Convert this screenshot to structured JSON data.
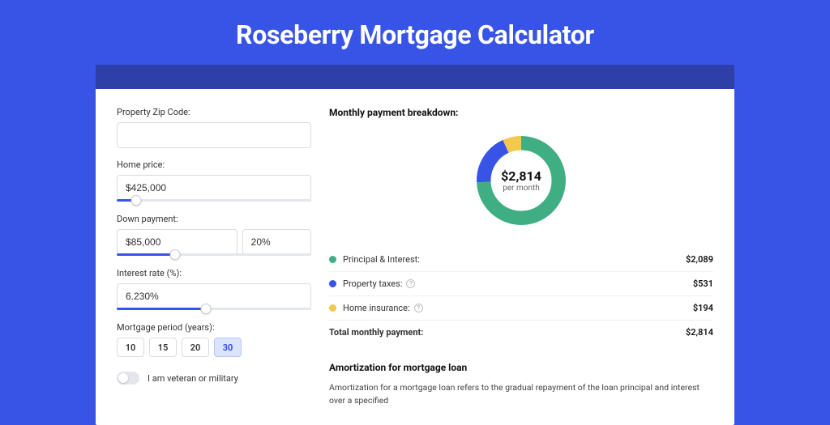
{
  "page_title": "Roseberry Mortgage Calculator",
  "form": {
    "zip": {
      "label": "Property Zip Code:",
      "value": ""
    },
    "home_price": {
      "label": "Home price:",
      "value": "$425,000",
      "slider_pct": 10
    },
    "down_payment": {
      "label": "Down payment:",
      "amount": "$85,000",
      "percent": "20%",
      "slider_pct": 30
    },
    "interest_rate": {
      "label": "Interest rate (%):",
      "value": "6.230%",
      "slider_pct": 46
    },
    "mortgage_period": {
      "label": "Mortgage period (years):",
      "options": [
        "10",
        "15",
        "20",
        "30"
      ],
      "selected": "30"
    },
    "veteran": {
      "label": "I am veteran or military",
      "on": false
    }
  },
  "breakdown": {
    "title": "Monthly payment breakdown:",
    "center_amount": "$2,814",
    "center_sub": "per month",
    "items": [
      {
        "label": "Principal & Interest:",
        "value": "$2,089",
        "color": "#3fae82",
        "info": false
      },
      {
        "label": "Property taxes:",
        "value": "$531",
        "color": "#3754e6",
        "info": true
      },
      {
        "label": "Home insurance:",
        "value": "$194",
        "color": "#f2c94c",
        "info": true
      }
    ],
    "total": {
      "label": "Total monthly payment:",
      "value": "$2,814"
    }
  },
  "chart_data": {
    "type": "pie",
    "title": "Monthly payment breakdown",
    "series": [
      {
        "name": "Principal & Interest",
        "value": 2089,
        "color": "#3fae82"
      },
      {
        "name": "Property taxes",
        "value": 531,
        "color": "#3754e6"
      },
      {
        "name": "Home insurance",
        "value": 194,
        "color": "#f2c94c"
      }
    ],
    "total": 2814,
    "center_label": "$2,814 per month"
  },
  "amortization": {
    "title": "Amortization for mortgage loan",
    "text": "Amortization for a mortgage loan refers to the gradual repayment of the loan principal and interest over a specified"
  }
}
